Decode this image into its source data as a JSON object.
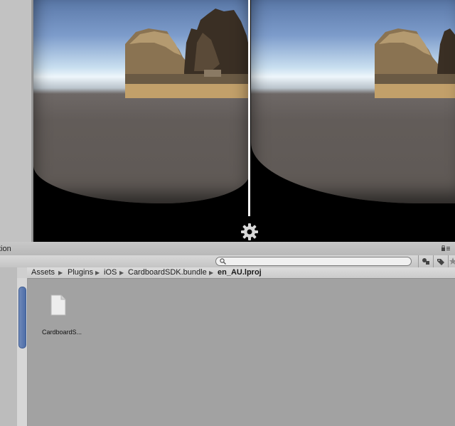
{
  "panel": {
    "tab_label": "tion"
  },
  "search": {
    "placeholder": "",
    "value": ""
  },
  "breadcrumb": {
    "items": [
      "Assets",
      "Plugins",
      "iOS",
      "CardboardSDK.bundle",
      "en_AU.lproj"
    ]
  },
  "assets": {
    "items": [
      {
        "name": "CardboardS...",
        "icon": "file-icon"
      }
    ]
  },
  "colors": {
    "accent_scrollbar": "#4e6ea8",
    "panel_bg": "#a2a2a2",
    "divider": "#f5f5f5"
  }
}
